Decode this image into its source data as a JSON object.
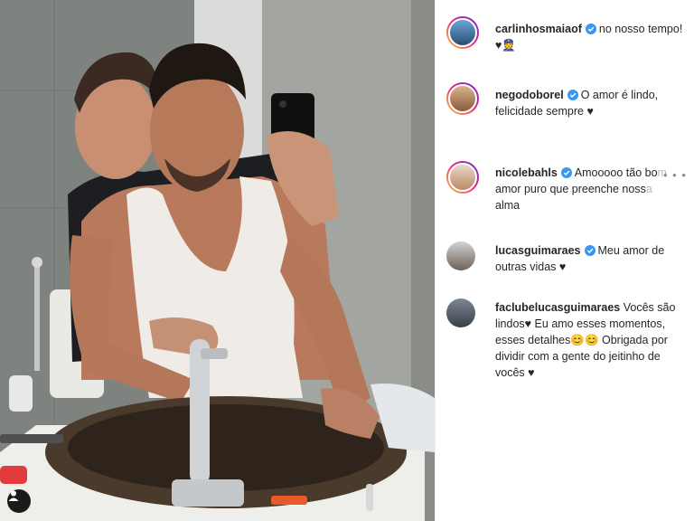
{
  "post": {
    "photo_alt": "",
    "tag_icon": "user-tag-icon"
  },
  "comments": [
    {
      "username": "carlinhosmaiaof",
      "verified": true,
      "text": "no nosso tempo!",
      "text_line2": "♥",
      "emoji": "👮",
      "story_ring": true
    },
    {
      "username": "negodoborel",
      "verified": true,
      "text": "O amor é lindo,",
      "text_line2": "felicidade sempre ♥",
      "story_ring": true
    },
    {
      "username": "nicolebahls",
      "verified": true,
      "text": "Amooooo tão bo",
      "text_fade": "m",
      "text_line2": "amor puro que preenche noss",
      "text_line2_fade": "a",
      "text_line3": "alma",
      "story_ring": true
    },
    {
      "username": "lucasguimaraes",
      "verified": true,
      "text": "Meu amor de",
      "text_line2": "outras vidas ♥",
      "story_ring": false
    },
    {
      "username": "faclubelucasguimaraes",
      "verified": false,
      "text": "Vocês são",
      "text_line2": "lindos♥ Eu amo esses momentos,",
      "text_line3": "esses detalhes😊😊 Obrigada por",
      "text_line4": "dividir com a gente do jeitinho de",
      "text_line5": "vocês ♥",
      "story_ring": false
    }
  ],
  "more_options": "• • •",
  "colors": {
    "verified": "#3897f0",
    "text": "#262626",
    "muted": "#8e8e8e"
  }
}
